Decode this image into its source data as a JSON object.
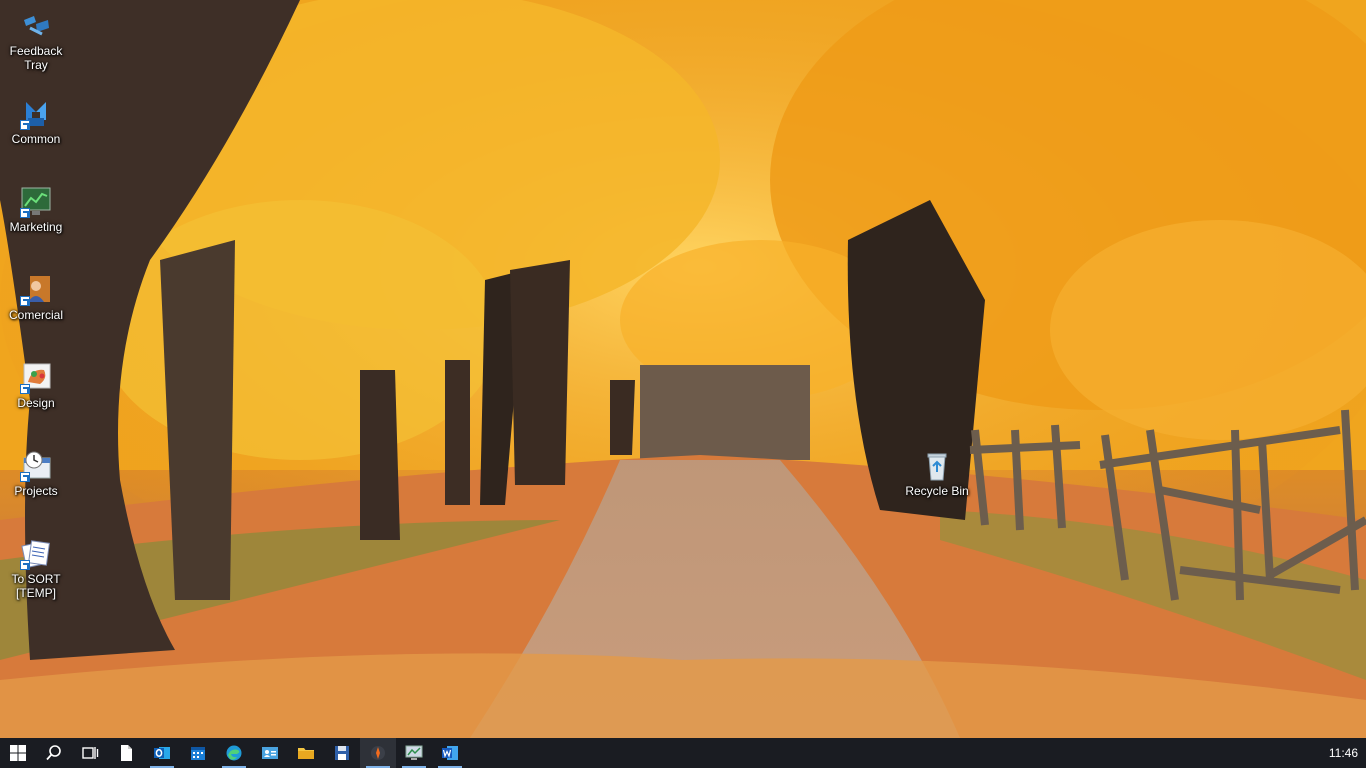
{
  "desktop": {
    "icons": [
      {
        "label": "Feedback Tray",
        "icon": "feedback-tray-icon",
        "shortcut": false
      },
      {
        "label": "Common",
        "icon": "arrows-folder-icon",
        "shortcut": true
      },
      {
        "label": "Marketing",
        "icon": "chart-monitor-icon",
        "shortcut": true
      },
      {
        "label": "Comercial",
        "icon": "person-box-icon",
        "shortcut": true
      },
      {
        "label": "Design",
        "icon": "paint-palette-icon",
        "shortcut": true
      },
      {
        "label": "Projects",
        "icon": "calendar-clock-icon",
        "shortcut": true
      },
      {
        "label": "To SORT [TEMP]",
        "icon": "documents-stack-icon",
        "shortcut": true
      },
      {
        "label": "Recycle Bin",
        "icon": "recycle-bin-icon",
        "shortcut": false
      }
    ]
  },
  "taskbar": {
    "buttons": [
      {
        "name": "start-button",
        "icon": "windows-logo-icon"
      },
      {
        "name": "search-button",
        "icon": "search-icon"
      },
      {
        "name": "task-view-button",
        "icon": "task-view-icon"
      },
      {
        "name": "notepad-button",
        "icon": "document-icon"
      },
      {
        "name": "outlook-button",
        "icon": "outlook-icon"
      },
      {
        "name": "calendar-button",
        "icon": "calendar-icon"
      },
      {
        "name": "edge-button",
        "icon": "edge-icon"
      },
      {
        "name": "contacts-button",
        "icon": "contact-card-icon"
      },
      {
        "name": "file-explorer-button",
        "icon": "folder-icon"
      },
      {
        "name": "save-app-button",
        "icon": "floppy-icon"
      },
      {
        "name": "media-app-button",
        "icon": "media-icon"
      },
      {
        "name": "remote-desktop-button",
        "icon": "monitor-icon"
      },
      {
        "name": "word-button",
        "icon": "word-icon"
      }
    ],
    "clock": "11:46"
  },
  "colors": {
    "taskbar_bg": "#1a1c22",
    "running_indicator": "#7fb2e8",
    "accent_blue": "#1c6fc2"
  }
}
